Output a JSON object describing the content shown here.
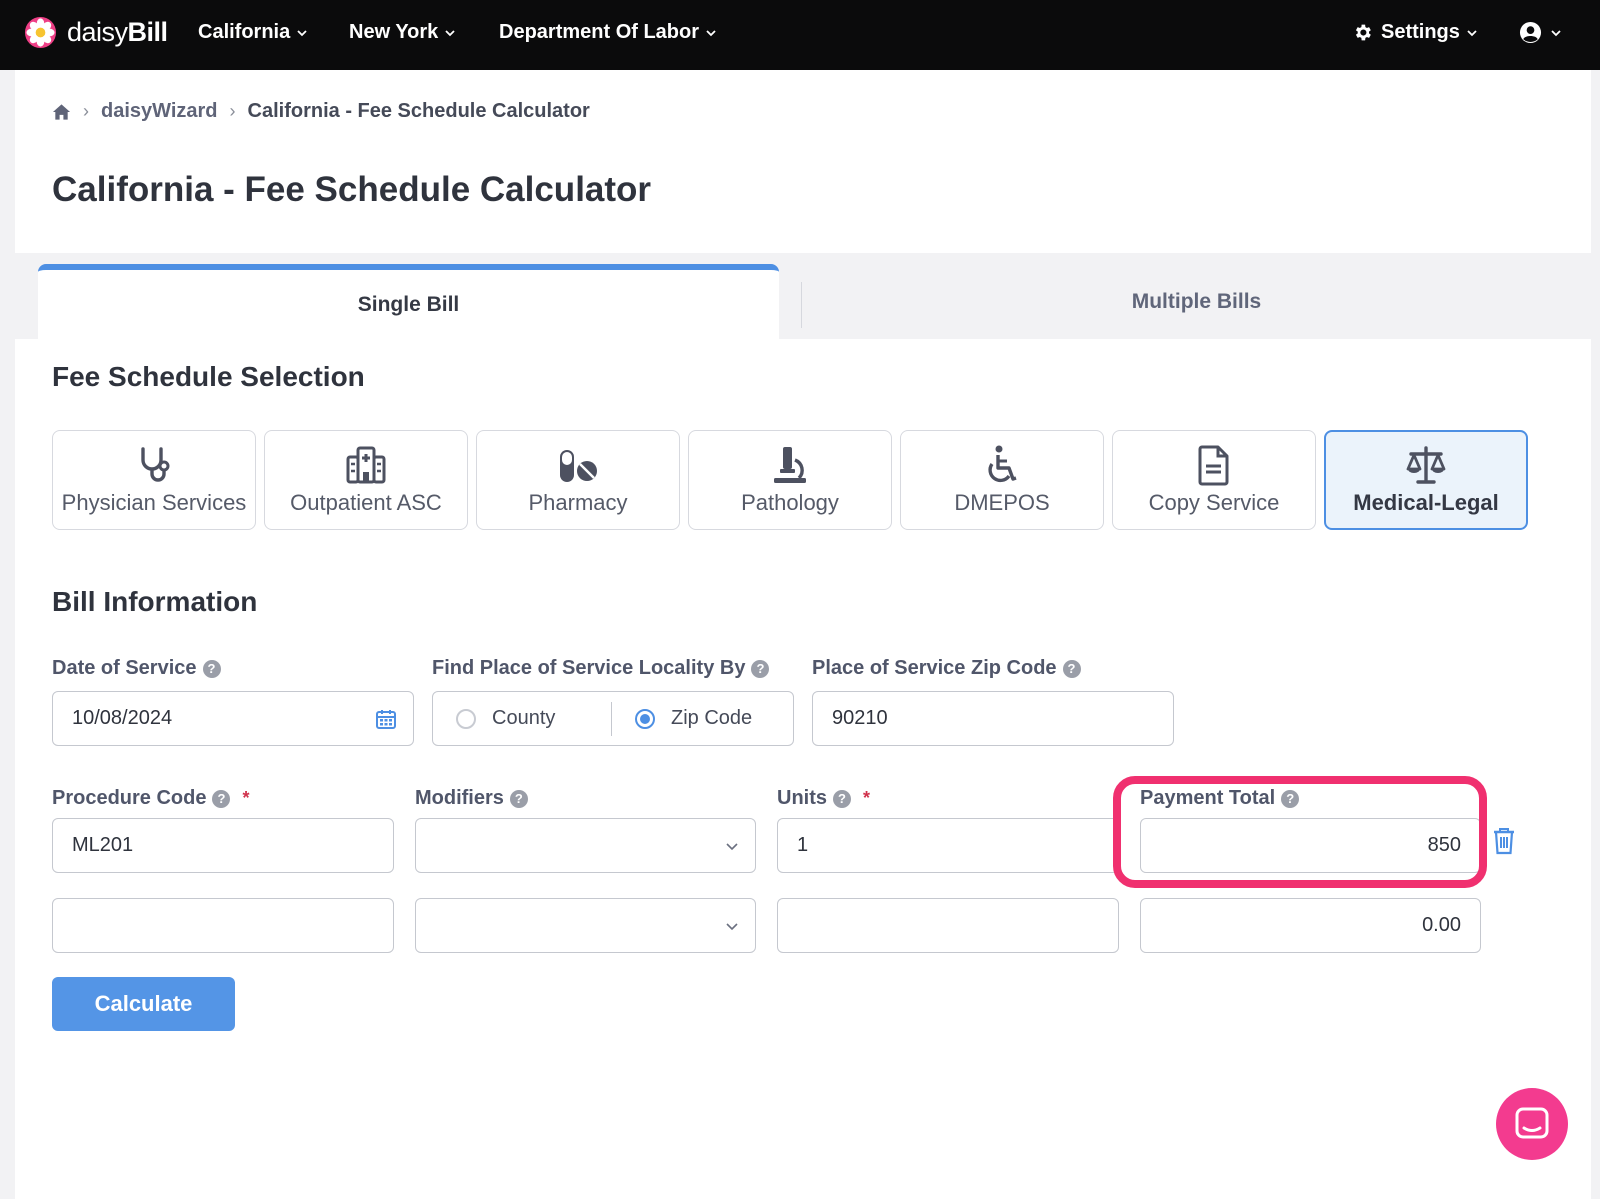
{
  "nav": {
    "brand_light": "daisy",
    "brand_bold": "Bill",
    "menus": [
      "California",
      "New York",
      "Department Of Labor"
    ],
    "settings_label": "Settings"
  },
  "breadcrumb": {
    "items": [
      "daisyWizard",
      "California - Fee Schedule Calculator"
    ]
  },
  "page_title": "California - Fee Schedule Calculator",
  "tabs": [
    "Single Bill",
    "Multiple Bills"
  ],
  "fee_schedule": {
    "title": "Fee Schedule Selection",
    "options": [
      {
        "label": "Physician Services",
        "icon": "stethoscope-icon"
      },
      {
        "label": "Outpatient ASC",
        "icon": "hospital-icon"
      },
      {
        "label": "Pharmacy",
        "icon": "pills-icon"
      },
      {
        "label": "Pathology",
        "icon": "microscope-icon"
      },
      {
        "label": "DMEPOS",
        "icon": "wheelchair-icon"
      },
      {
        "label": "Copy Service",
        "icon": "document-icon"
      },
      {
        "label": "Medical-Legal",
        "icon": "scales-icon"
      }
    ],
    "selected": "Medical-Legal"
  },
  "bill_info": {
    "title": "Bill Information",
    "date_label": "Date of Service",
    "date_value": "10/08/2024",
    "locality_label": "Find Place of Service Locality By",
    "locality_options": [
      "County",
      "Zip Code"
    ],
    "locality_selected": "Zip Code",
    "zip_label": "Place of Service Zip Code",
    "zip_value": "90210",
    "procedure_label": "Procedure Code",
    "modifiers_label": "Modifiers",
    "units_label": "Units",
    "payment_label": "Payment Total",
    "required_mark": "*",
    "rows": [
      {
        "procedure": "ML201",
        "modifiers": "",
        "units": "1",
        "payment": "850"
      },
      {
        "procedure": "",
        "modifiers": "",
        "units": "",
        "payment": "0.00"
      }
    ],
    "calculate_label": "Calculate"
  },
  "colors": {
    "accent": "#4d8fe3",
    "highlight": "#f0306f",
    "chat": "#f33b8f",
    "nav_bg": "#0b0b0c"
  }
}
